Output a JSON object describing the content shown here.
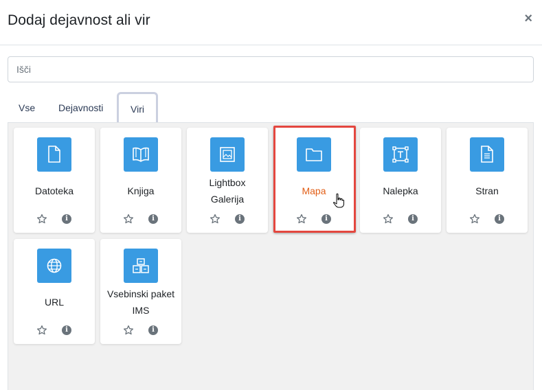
{
  "dialog": {
    "title": "Dodaj dejavnost ali vir",
    "close_label": "×"
  },
  "search": {
    "placeholder": "Išči",
    "value": ""
  },
  "tabs": [
    {
      "label": "Vse",
      "active": false
    },
    {
      "label": "Dejavnosti",
      "active": false
    },
    {
      "label": "Viri",
      "active": true
    }
  ],
  "items": [
    {
      "name": "Datoteka",
      "icon": "file-icon"
    },
    {
      "name": "Knjiga",
      "icon": "book-icon"
    },
    {
      "name": "Lightbox Galerija",
      "icon": "image-gallery-icon"
    },
    {
      "name": "Mapa",
      "icon": "folder-icon",
      "highlighted": true
    },
    {
      "name": "Nalepka",
      "icon": "text-label-icon"
    },
    {
      "name": "Stran",
      "icon": "page-icon"
    },
    {
      "name": "URL",
      "icon": "globe-icon"
    },
    {
      "name": "Vsebinski paket IMS",
      "icon": "package-icon"
    }
  ],
  "colors": {
    "icon_bg": "#399be2",
    "highlight_border": "#e4473f",
    "highlight_text": "#e25e16"
  }
}
